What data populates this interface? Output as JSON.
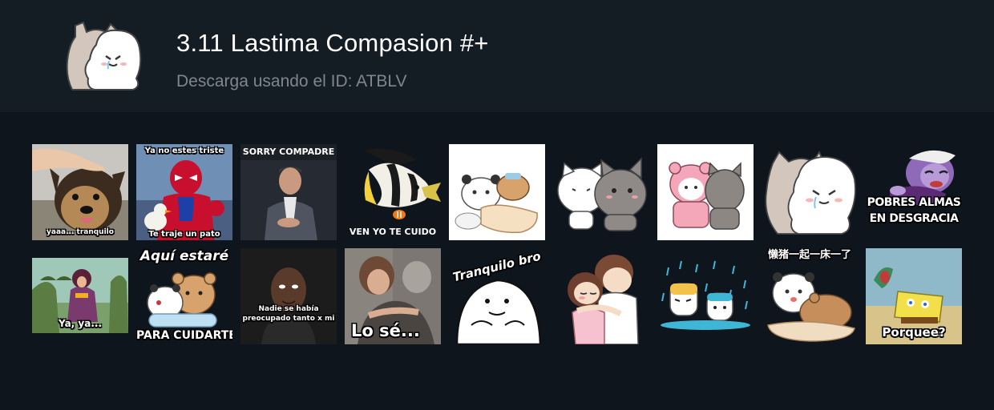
{
  "pack": {
    "title": "3.11 Lastima Compasion #+",
    "subtitle": "Descarga usando el ID: ATBLV",
    "icon": "hugging-cats-icon"
  },
  "stickers": [
    {
      "icon": "dog-head-pat-sticker",
      "caption": "yaaa... tranquilo"
    },
    {
      "icon": "spiderman-duck-sticker",
      "caption_top": "Ya no estes triste",
      "caption": "Te traje un pato"
    },
    {
      "icon": "man-sitting-sticker",
      "caption_top": "SORRY COMPADRE"
    },
    {
      "icon": "fish-sticker",
      "caption": "VEN YO TE CUIDO"
    },
    {
      "icon": "bears-in-bed-sticker"
    },
    {
      "icon": "cats-hug-sticker"
    },
    {
      "icon": "pink-hood-cats-sticker"
    },
    {
      "icon": "cats-cuddle-sticker"
    },
    {
      "icon": "ursula-sticker",
      "caption": "POBRES ALMAS",
      "caption2": "EN DESGRACIA"
    },
    {
      "icon": "cartoon-hug-sticker",
      "caption": "Ya, ya..."
    },
    {
      "icon": "bear-care-sticker",
      "caption_top": "Aquí estaré",
      "caption": "PARA CUIDARTE"
    },
    {
      "icon": "terry-crews-sticker",
      "caption": "Nadie se había",
      "caption2": "preocupado tanto x mi"
    },
    {
      "icon": "embrace-photo-sticker",
      "caption": "Lo sé..."
    },
    {
      "icon": "flork-sticker",
      "caption_top": "Tranquilo bro"
    },
    {
      "icon": "couple-hug-sticker"
    },
    {
      "icon": "crying-cats-sticker"
    },
    {
      "icon": "bears-comfort-sticker",
      "caption_top": "懒猪一起一床一了"
    },
    {
      "icon": "spongebob-sticker",
      "caption": "Porquee?"
    }
  ]
}
